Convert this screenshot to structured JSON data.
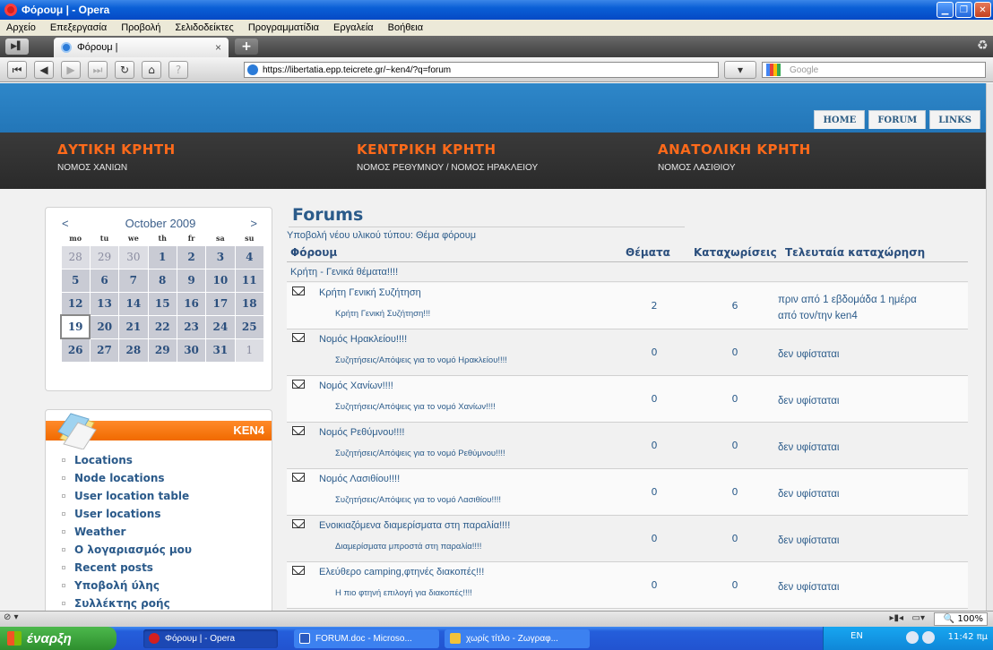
{
  "window": {
    "title": "Φόρουμ | - Opera",
    "buttons": [
      "minimize",
      "maximize",
      "close"
    ]
  },
  "menu": [
    "Αρχείο",
    "Επεξεργασία",
    "Προβολή",
    "Σελιδοδείκτες",
    "Προγραμματίδια",
    "Εργαλεία",
    "Βοήθεια"
  ],
  "tab": {
    "title": "Φόρουμ |",
    "close": "×",
    "new": "+"
  },
  "address": {
    "url": "https://libertatia.epp.teicrete.gr/~ken4/?q=forum",
    "search_placeholder": "Google"
  },
  "site": {
    "primary_links": [
      "HOME",
      "FORUM",
      "LINKS"
    ],
    "regions": [
      {
        "title": "ΔΥΤΙΚΗ ΚΡΗΤΗ",
        "subtitle": "ΝΟΜΟΣ ΧΑΝΙΩΝ"
      },
      {
        "title": "ΚΕΝΤΡΙΚΗ ΚΡΗΤΗ",
        "subtitle": "ΝΟΜΟΣ ΡΕΘΥΜΝΟΥ / ΝΟΜΟΣ ΗΡΑΚΛΕΙΟΥ"
      },
      {
        "title": "ΑΝΑΤΟΛΙΚΗ ΚΡΗΤΗ",
        "subtitle": "ΝΟΜΟΣ ΛΑΣΙΘΙΟΥ"
      }
    ]
  },
  "calendar": {
    "prev": "<",
    "next": ">",
    "month": "October 2009",
    "days": [
      "mo",
      "tu",
      "we",
      "th",
      "fr",
      "sa",
      "su"
    ],
    "weeks": [
      [
        "28",
        "29",
        "30",
        "1",
        "2",
        "3",
        "4"
      ],
      [
        "5",
        "6",
        "7",
        "8",
        "9",
        "10",
        "11"
      ],
      [
        "12",
        "13",
        "14",
        "15",
        "16",
        "17",
        "18"
      ],
      [
        "19",
        "20",
        "21",
        "22",
        "23",
        "24",
        "25"
      ],
      [
        "26",
        "27",
        "28",
        "29",
        "30",
        "31",
        "1"
      ]
    ],
    "today": "19"
  },
  "ken_block": {
    "title": "KEN4",
    "links": [
      "Locations",
      "Node locations",
      "User location table",
      "User locations",
      "Weather",
      "Ο λογαριασμός μου",
      "Recent posts",
      "Υποβολή ύλης",
      "Συλλέκτης ροής"
    ]
  },
  "forum": {
    "title": "Forums",
    "submit_link": "Υποβολή νέου υλικού τύπου: Θέμα φόρουμ",
    "columns": {
      "forum": "Φόρουμ",
      "topics": "Θέματα",
      "posts": "Καταχωρίσεις",
      "last": "Τελευταία καταχώρηση"
    },
    "category": "Κρήτη - Γενικά θέματα!!!!",
    "rows": [
      {
        "name": "Κρήτη Γενική Συζήτηση",
        "desc": "Κρήτη Γενική Συζήτηση!!!",
        "topics": "2",
        "posts": "6",
        "last_1": "πριν από 1 εβδομάδα 1 ημέρα",
        "last_2": "από τον/την ken4"
      },
      {
        "name": "Νομός Ηρακλείου!!!!",
        "desc": "Συζητήσεις/Απόψεις για το νομό Ηρακλείου!!!!",
        "topics": "0",
        "posts": "0",
        "last_1": "δεν υφίσταται",
        "last_2": ""
      },
      {
        "name": "Νομός Χανίων!!!!",
        "desc": "Συζητήσεις/Απόψεις για το νομό Χανίων!!!!",
        "topics": "0",
        "posts": "0",
        "last_1": "δεν υφίσταται",
        "last_2": ""
      },
      {
        "name": "Νομός Ρεθύμνου!!!!",
        "desc": "Συζητήσεις/Απόψεις για το νομό Ρεθύμνου!!!!",
        "topics": "0",
        "posts": "0",
        "last_1": "δεν υφίσταται",
        "last_2": ""
      },
      {
        "name": "Νομός Λασιθίου!!!!",
        "desc": "Συζητήσεις/Απόψεις για το νομό Λασιθίου!!!!",
        "topics": "0",
        "posts": "0",
        "last_1": "δεν υφίσταται",
        "last_2": ""
      },
      {
        "name": "Ενοικιαζόμενα διαμερίσματα στη παραλία!!!!",
        "desc": "Διαμερίσματα μπροστά στη παραλία!!!!",
        "topics": "0",
        "posts": "0",
        "last_1": "δεν υφίσταται",
        "last_2": ""
      },
      {
        "name": "Ελεύθερο camping,φτηνές διακοπές!!!",
        "desc": "Η πιο φτηνή επιλογή για διακοπές!!!!",
        "topics": "0",
        "posts": "0",
        "last_1": "δεν υφίσταται",
        "last_2": ""
      }
    ]
  },
  "statusbar": {
    "zoom": "100%"
  },
  "taskbar": {
    "start": "έναρξη",
    "items": [
      "Φόρουμ | - Opera",
      "FORUM.doc - Microso...",
      "χωρίς τίτλο - Ζωγραφ..."
    ],
    "lang": "EN",
    "clock": "11:42 πμ"
  }
}
